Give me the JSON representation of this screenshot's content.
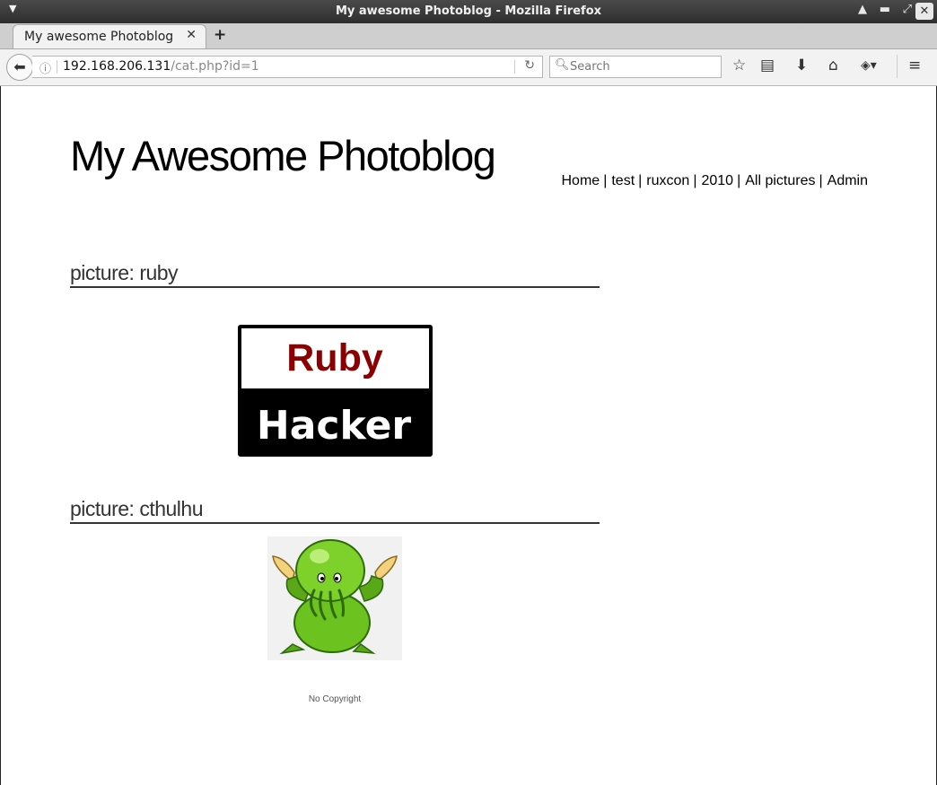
{
  "window": {
    "title": "My awesome Photoblog - Mozilla Firefox"
  },
  "tab": {
    "title": "My awesome Photoblog"
  },
  "urlbar": {
    "host": "192.168.206.131",
    "path": "/cat.php?id=1"
  },
  "search": {
    "placeholder": "Search"
  },
  "site": {
    "title": "My Awesome Photoblog",
    "nav": [
      {
        "label": "Home"
      },
      {
        "label": "test"
      },
      {
        "label": "ruxcon"
      },
      {
        "label": "2010"
      },
      {
        "label": "All pictures"
      },
      {
        "label": "Admin"
      }
    ]
  },
  "posts": [
    {
      "title": "picture: ruby",
      "image": {
        "line1": "Ruby",
        "line2": "Hacker",
        "accent": "#8b0000"
      }
    },
    {
      "title": "picture: cthulhu"
    }
  ],
  "footer": {
    "text": "No Copyright"
  }
}
